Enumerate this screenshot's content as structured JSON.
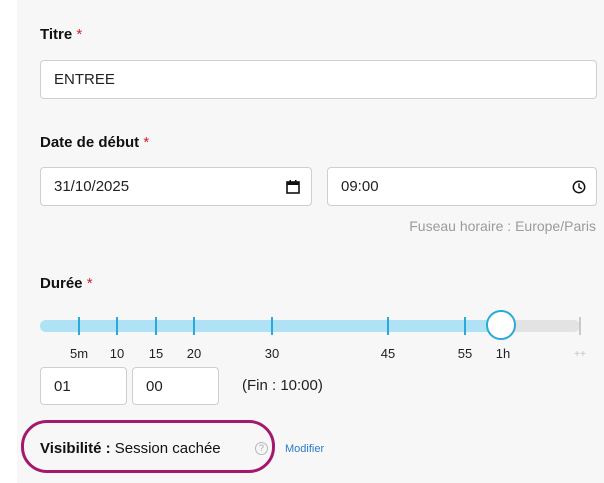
{
  "form": {
    "title": {
      "label": "Titre",
      "required_mark": "*",
      "value": "ENTREE"
    },
    "start_date": {
      "label": "Date de début",
      "required_mark": "*",
      "date_value": "31/10/2025",
      "date_icon": "calendar-icon",
      "time_value": "09:00",
      "time_icon": "clock-icon",
      "timezone_text": "Fuseau horaire : Europe/Paris"
    },
    "duration": {
      "label": "Durée",
      "required_mark": "*",
      "slider": {
        "selected": "1h",
        "fill_fraction": 0.86,
        "ticks": [
          "5m",
          "10",
          "15",
          "20",
          "30",
          "45",
          "55",
          "1h",
          "++"
        ]
      },
      "hours_value": "01",
      "minutes_value": "00",
      "end_text": "(Fin : 10:00)"
    },
    "visibility": {
      "label": "Visibilité :",
      "value": "Session cachée",
      "help_icon": "question-icon",
      "help_glyph": "?",
      "modify_link": "Modifier",
      "highlight_color": "#a4196e"
    }
  },
  "colors": {
    "required": "#d0202b",
    "accent": "#2ba9d9",
    "slider_fill": "#aee2f4",
    "link": "#2a7cc8"
  }
}
